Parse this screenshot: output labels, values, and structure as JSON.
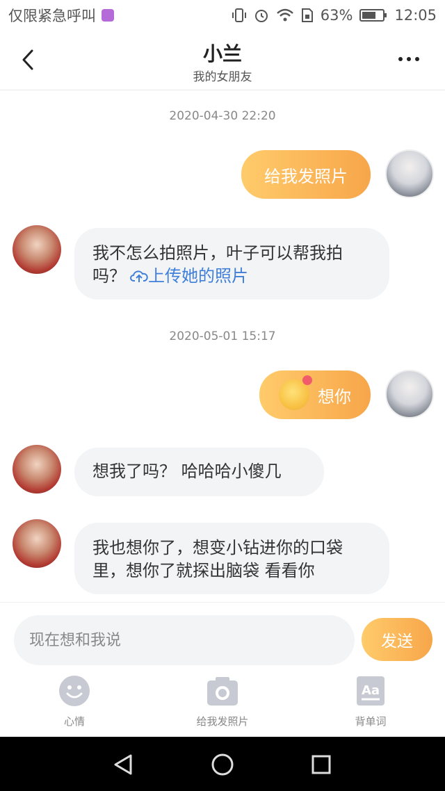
{
  "status_bar": {
    "carrier": "仅限紧急呼叫",
    "battery": "63%",
    "time": "12:05"
  },
  "header": {
    "title": "小兰",
    "subtitle": "我的女朋友"
  },
  "messages": [
    {
      "timestamp": "2020-04-30  22:20"
    },
    {
      "sender": "me",
      "text": "给我发照片"
    },
    {
      "sender": "her",
      "text": "我不怎么拍照片，叶子可以帮我拍吗？",
      "link": "上传她的照片"
    },
    {
      "timestamp": "2020-05-01  15:17"
    },
    {
      "sender": "me",
      "text": "想你",
      "emoji": "smiling-face-with-hearts"
    },
    {
      "sender": "her",
      "text": "想我了吗？  哈哈哈小傻几"
    },
    {
      "sender": "her",
      "text": "我也想你了，想变小钻进你的口袋里，想你了就探出脑袋 看看你"
    }
  ],
  "input": {
    "placeholder": "现在想和我说",
    "send_label": "发送"
  },
  "toolbar": {
    "mood_label": "心情",
    "photo_label": "给我发照片",
    "words_label": "背单词"
  },
  "colors": {
    "accent_start": "#ffcb6b",
    "accent_end": "#f7a64a",
    "link": "#3f7fd9",
    "bubble_in": "#f3f4f6"
  }
}
